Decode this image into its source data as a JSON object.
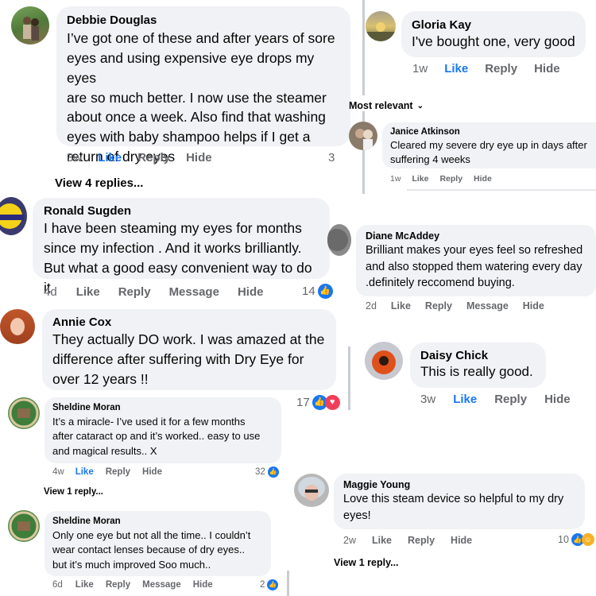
{
  "comments": [
    {
      "name": "Debbie Douglas",
      "lines": [
        "I’ve got one of these and after years of sore",
        "eyes and using expensive eye drops my eyes",
        "are so much better. I now use the steamer",
        "about once a week. Also find that washing",
        "eyes with baby shampoo helps if I get a",
        "return of dry eyes"
      ],
      "time": "3w",
      "like": "Like",
      "reply": "Reply",
      "hide": "Hide",
      "count": "3",
      "view_replies": "View 4 replies..."
    },
    {
      "name": "Ronald Sugden",
      "lines": [
        "I have been steaming my eyes for months",
        "since my infection . And it works brilliantly.",
        "But what a good easy convenient way to do it"
      ],
      "time": "4d",
      "like": "Like",
      "reply": "Reply",
      "message": "Message",
      "hide": "Hide",
      "count": "14"
    },
    {
      "name": "Annie Cox",
      "lines": [
        "They actually  DO work.  I was amazed at the",
        "difference after suffering with Dry Eye for",
        "over 12 years !!"
      ],
      "count": "17"
    },
    {
      "name": "Sheldine Moran",
      "lines": [
        "It’s a miracle- I’ve used it for a few months",
        "after cataract op and it’s worked.. easy to use",
        "and magical results.. X"
      ],
      "time": "4w",
      "like": "Like",
      "reply": "Reply",
      "hide": "Hide",
      "count": "32",
      "view_replies": "View 1 reply..."
    },
    {
      "name": "Sheldine Moran",
      "lines": [
        "Only one eye but not all the time.. I couldn’t",
        "wear contact lenses because of dry eyes..",
        "but it’s much improved Soo much.."
      ],
      "time": "6d",
      "like": "Like",
      "reply": "Reply",
      "message": "Message",
      "hide": "Hide",
      "count": "2"
    },
    {
      "name": "Gloria Kay",
      "lines": [
        "I've bought one, very good"
      ],
      "time": "1w",
      "like": "Like",
      "reply": "Reply",
      "hide": "Hide"
    },
    {
      "sort_label": "Most relevant",
      "name": "Janice Atkinson",
      "lines": [
        "Cleared my severe dry eye up in days after",
        "suffering 4 weeks"
      ],
      "time": "1w",
      "like": "Like",
      "reply": "Reply",
      "hide": "Hide"
    },
    {
      "name": "Diane McAddey",
      "lines": [
        "Brilliant  makes your eyes feel so refreshed",
        "and also stopped them watering every day",
        ".definitely reccomend buying."
      ],
      "time": "2d",
      "like": "Like",
      "reply": "Reply",
      "message": "Message",
      "hide": "Hide"
    },
    {
      "name": "Daisy Chick",
      "lines": [
        "This is really good."
      ],
      "time": "3w",
      "like": "Like",
      "reply": "Reply",
      "hide": "Hide"
    },
    {
      "name": "Maggie Young",
      "lines": [
        "Love this steam device so helpful to my dry",
        "eyes!"
      ],
      "time": "2w",
      "like": "Like",
      "reply": "Reply",
      "hide": "Hide",
      "count": "10",
      "view_replies": "View 1 reply..."
    }
  ],
  "colors": {
    "bubble": "#f0f2f5",
    "meta": "#65676b",
    "like_blue": "#1877f2",
    "love_red": "#f33e58"
  },
  "icons": {
    "like": "thumbs-up-icon",
    "love": "heart-icon",
    "care": "care-icon",
    "chevron": "chevron-down-icon"
  }
}
